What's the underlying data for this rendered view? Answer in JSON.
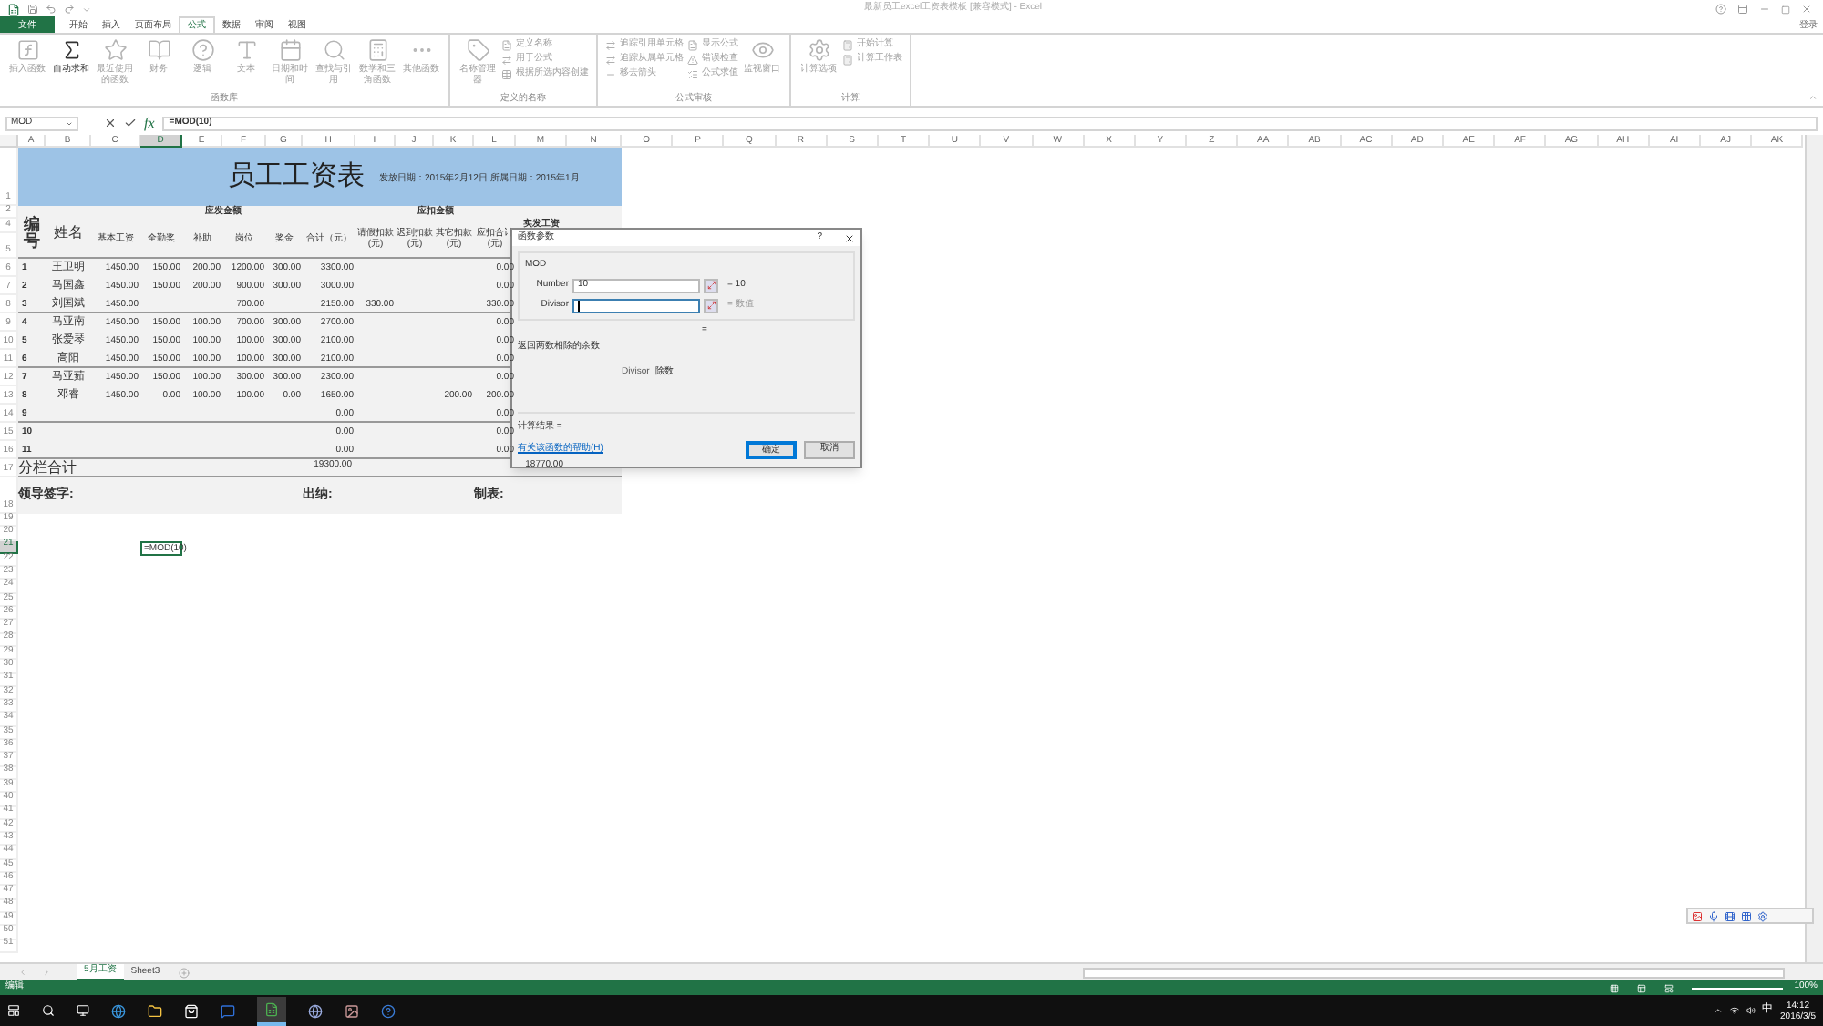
{
  "window": {
    "title": "最新员工excel工资表模板 [兼容模式] - Excel",
    "sign_in": "登录"
  },
  "ribbon_tabs": [
    {
      "label": "文件",
      "selected": false,
      "kind": "file"
    },
    {
      "label": "开始",
      "selected": false,
      "kind": "tab"
    },
    {
      "label": "插入",
      "selected": false,
      "kind": "tab"
    },
    {
      "label": "页面布局",
      "selected": false,
      "kind": "tab"
    },
    {
      "label": "公式",
      "selected": true,
      "kind": "tab"
    },
    {
      "label": "数据",
      "selected": false,
      "kind": "tab"
    },
    {
      "label": "审阅",
      "selected": false,
      "kind": "tab"
    },
    {
      "label": "视图",
      "selected": false,
      "kind": "tab"
    }
  ],
  "ribbon_groups": [
    {
      "label": "函数库",
      "items": [
        {
          "label": "插入函数",
          "kind": "large",
          "disabled": true
        },
        {
          "label": "自动求和",
          "kind": "large",
          "disabled": false
        },
        {
          "label": "最近使用的函数",
          "kind": "large",
          "disabled": true
        },
        {
          "label": "财务",
          "kind": "large",
          "disabled": true
        },
        {
          "label": "逻辑",
          "kind": "large",
          "disabled": true
        },
        {
          "label": "文本",
          "kind": "large",
          "disabled": true
        },
        {
          "label": "日期和时间",
          "kind": "large",
          "disabled": true
        },
        {
          "label": "查找与引用",
          "kind": "large",
          "disabled": true
        },
        {
          "label": "数学和三角函数",
          "kind": "large",
          "disabled": true
        },
        {
          "label": "其他函数",
          "kind": "large",
          "disabled": true
        }
      ]
    },
    {
      "label": "定义的名称",
      "items": [
        {
          "label": "名称管理器",
          "kind": "large",
          "disabled": true
        },
        {
          "label": "定义名称",
          "kind": "small",
          "disabled": true
        },
        {
          "label": "用于公式",
          "kind": "small",
          "disabled": true
        },
        {
          "label": "根据所选内容创建",
          "kind": "small",
          "disabled": true
        }
      ]
    },
    {
      "label": "公式审核",
      "items": [
        {
          "label": "追踪引用单元格",
          "kind": "small",
          "disabled": true
        },
        {
          "label": "追踪从属单元格",
          "kind": "small",
          "disabled": true
        },
        {
          "label": "移去箭头",
          "kind": "small",
          "disabled": true
        },
        {
          "label": "显示公式",
          "kind": "small",
          "disabled": true
        },
        {
          "label": "错误检查",
          "kind": "small",
          "disabled": true
        },
        {
          "label": "公式求值",
          "kind": "small",
          "disabled": true
        },
        {
          "label": "监视窗口",
          "kind": "large",
          "disabled": true
        }
      ]
    },
    {
      "label": "计算",
      "items": [
        {
          "label": "计算选项",
          "kind": "large",
          "disabled": true
        },
        {
          "label": "开始计算",
          "kind": "small",
          "disabled": true
        },
        {
          "label": "计算工作表",
          "kind": "small",
          "disabled": true
        }
      ]
    }
  ],
  "formula_bar": {
    "name_box": "MOD",
    "fx": "fx",
    "formula": "=MOD(10)"
  },
  "columns": [
    {
      "label": "A",
      "selected": false
    },
    {
      "label": "B",
      "selected": false
    },
    {
      "label": "C",
      "selected": false
    },
    {
      "label": "D",
      "selected": true
    },
    {
      "label": "E",
      "selected": false
    },
    {
      "label": "F",
      "selected": false
    },
    {
      "label": "G",
      "selected": false
    },
    {
      "label": "H",
      "selected": false
    },
    {
      "label": "I",
      "selected": false
    },
    {
      "label": "J",
      "selected": false
    },
    {
      "label": "K",
      "selected": false
    },
    {
      "label": "L",
      "selected": false
    },
    {
      "label": "M",
      "selected": false
    },
    {
      "label": "N",
      "selected": false
    },
    {
      "label": "O",
      "selected": false
    },
    {
      "label": "P",
      "selected": false
    },
    {
      "label": "Q",
      "selected": false
    },
    {
      "label": "R",
      "selected": false
    },
    {
      "label": "S",
      "selected": false
    },
    {
      "label": "T",
      "selected": false
    },
    {
      "label": "U",
      "selected": false
    },
    {
      "label": "V",
      "selected": false
    },
    {
      "label": "W",
      "selected": false
    },
    {
      "label": "X",
      "selected": false
    },
    {
      "label": "Y",
      "selected": false
    },
    {
      "label": "Z",
      "selected": false
    },
    {
      "label": "AA",
      "selected": false
    },
    {
      "label": "AB",
      "selected": false
    },
    {
      "label": "AC",
      "selected": false
    },
    {
      "label": "AD",
      "selected": false
    },
    {
      "label": "AE",
      "selected": false
    },
    {
      "label": "AF",
      "selected": false
    },
    {
      "label": "AG",
      "selected": false
    },
    {
      "label": "AH",
      "selected": false
    },
    {
      "label": "AI",
      "selected": false
    },
    {
      "label": "AJ",
      "selected": false
    },
    {
      "label": "AK",
      "selected": false
    }
  ],
  "row_numbers": [
    {
      "label": "1",
      "selected": false
    },
    {
      "label": "2",
      "selected": false
    },
    {
      "label": "4",
      "selected": false
    },
    {
      "label": "5",
      "selected": false
    },
    {
      "label": "6",
      "selected": false
    },
    {
      "label": "7",
      "selected": false
    },
    {
      "label": "8",
      "selected": false
    },
    {
      "label": "9",
      "selected": false
    },
    {
      "label": "10",
      "selected": false
    },
    {
      "label": "11",
      "selected": false
    },
    {
      "label": "12",
      "selected": false
    },
    {
      "label": "13",
      "selected": false
    },
    {
      "label": "14",
      "selected": false
    },
    {
      "label": "15",
      "selected": false
    },
    {
      "label": "16",
      "selected": false
    },
    {
      "label": "17",
      "selected": false
    },
    {
      "label": "18",
      "selected": false
    },
    {
      "label": "19",
      "selected": false
    },
    {
      "label": "20",
      "selected": false
    },
    {
      "label": "21",
      "selected": true
    },
    {
      "label": "22",
      "selected": false
    },
    {
      "label": "23",
      "selected": false
    },
    {
      "label": "24",
      "selected": false
    },
    {
      "label": "25",
      "selected": false
    },
    {
      "label": "26",
      "selected": false
    },
    {
      "label": "27",
      "selected": false
    },
    {
      "label": "28",
      "selected": false
    },
    {
      "label": "29",
      "selected": false
    },
    {
      "label": "30",
      "selected": false
    },
    {
      "label": "31",
      "selected": false
    },
    {
      "label": "32",
      "selected": false
    },
    {
      "label": "33",
      "selected": false
    },
    {
      "label": "34",
      "selected": false
    },
    {
      "label": "35",
      "selected": false
    },
    {
      "label": "36",
      "selected": false
    },
    {
      "label": "37",
      "selected": false
    },
    {
      "label": "38",
      "selected": false
    },
    {
      "label": "39",
      "selected": false
    },
    {
      "label": "40",
      "selected": false
    },
    {
      "label": "41",
      "selected": false
    },
    {
      "label": "42",
      "selected": false
    },
    {
      "label": "43",
      "selected": false
    },
    {
      "label": "44",
      "selected": false
    },
    {
      "label": "45",
      "selected": false
    },
    {
      "label": "46",
      "selected": false
    },
    {
      "label": "47",
      "selected": false
    },
    {
      "label": "48",
      "selected": false
    },
    {
      "label": "49",
      "selected": false
    },
    {
      "label": "50",
      "selected": false
    },
    {
      "label": "51",
      "selected": false
    }
  ],
  "sheet": {
    "title": "员工工资表",
    "dates": "发放日期：2015年2月12日 所属日期：2015年1月",
    "group_headers": [
      "应发金额",
      "应扣金额"
    ],
    "column_headers": [
      "编号",
      "姓名",
      "基本工资",
      "全勤奖",
      "补助",
      "岗位",
      "奖金",
      "合计（元）",
      "请假扣款(元)",
      "迟到扣款(元)",
      "其它扣款(元)",
      "应扣合计(元)",
      "实发工资"
    ],
    "rows": [
      {
        "number": "1",
        "name": "王卫明",
        "base_pay": "1450.00",
        "attendance_bonus": "150.00",
        "allowance": "200.00",
        "post": "1200.00",
        "bonus": "300.00",
        "total": "3300.00",
        "deduction_total": "0.00"
      },
      {
        "number": "2",
        "name": "马国鑫",
        "base_pay": "1450.00",
        "attendance_bonus": "150.00",
        "allowance": "200.00",
        "post": "900.00",
        "bonus": "300.00",
        "total": "3000.00",
        "deduction_total": "0.00"
      },
      {
        "number": "3",
        "name": "刘国斌",
        "base_pay": "1450.00",
        "post": "700.00",
        "total": "2150.00",
        "leave_deduction": "330.00",
        "deduction_total": "330.00"
      },
      {
        "number": "4",
        "name": "马亚南",
        "base_pay": "1450.00",
        "attendance_bonus": "150.00",
        "allowance": "100.00",
        "post": "700.00",
        "bonus": "300.00",
        "total": "2700.00",
        "deduction_total": "0.00"
      },
      {
        "number": "5",
        "name": "张爱琴",
        "base_pay": "1450.00",
        "attendance_bonus": "150.00",
        "allowance": "100.00",
        "post": "100.00",
        "bonus": "300.00",
        "total": "2100.00",
        "deduction_total": "0.00"
      },
      {
        "number": "6",
        "name": "高阳",
        "base_pay": "1450.00",
        "attendance_bonus": "150.00",
        "allowance": "100.00",
        "post": "100.00",
        "bonus": "300.00",
        "total": "2100.00",
        "deduction_total": "0.00"
      },
      {
        "number": "7",
        "name": "马亚茹",
        "base_pay": "1450.00",
        "attendance_bonus": "150.00",
        "allowance": "100.00",
        "post": "300.00",
        "bonus": "300.00",
        "total": "2300.00",
        "deduction_total": "0.00"
      },
      {
        "number": "8",
        "name": "邓睿",
        "base_pay": "1450.00",
        "attendance_bonus": "0.00",
        "allowance": "100.00",
        "post": "100.00",
        "bonus": "0.00",
        "total": "1650.00",
        "other_deduction": "200.00",
        "deduction_total": "200.00"
      },
      {
        "number": "9",
        "total": "0.00",
        "deduction_total": "0.00"
      },
      {
        "number": "10",
        "total": "0.00",
        "deduction_total": "0.00"
      },
      {
        "number": "11",
        "total": "0.00",
        "deduction_total": "0.00"
      }
    ],
    "totals": {
      "label": "分栏合计",
      "total": "19300.00",
      "net_pay": "18770.00"
    },
    "signatures": [
      "领导签字:",
      "出纳:",
      "制表:"
    ],
    "editing_cell": "=MOD(10)"
  },
  "dialog": {
    "title": "函数参数",
    "help": "?",
    "function": "MOD",
    "arguments": [
      {
        "label": "Number",
        "value": "10",
        "result": "= 10",
        "focused": false
      },
      {
        "label": "Divisor",
        "result": "= 数值",
        "focused": true
      }
    ],
    "equals": "=",
    "description": "返回两数相除的余数",
    "arg_help_label": "Divisor",
    "arg_help": "除数",
    "result_label": "计算结果 =",
    "help_link": "有关该函数的帮助(H)",
    "buttons": [
      {
        "label": "确定",
        "default": true
      },
      {
        "label": "取消",
        "default": false
      }
    ]
  },
  "sheet_tabs": [
    {
      "label": "5月工资",
      "selected": true
    },
    {
      "label": "Sheet3",
      "selected": false
    }
  ],
  "status_bar": {
    "mode": "编辑",
    "zoom": "100%"
  },
  "taskbar": {
    "ime": "中",
    "time": "14:12",
    "date": "2016/3/5"
  }
}
